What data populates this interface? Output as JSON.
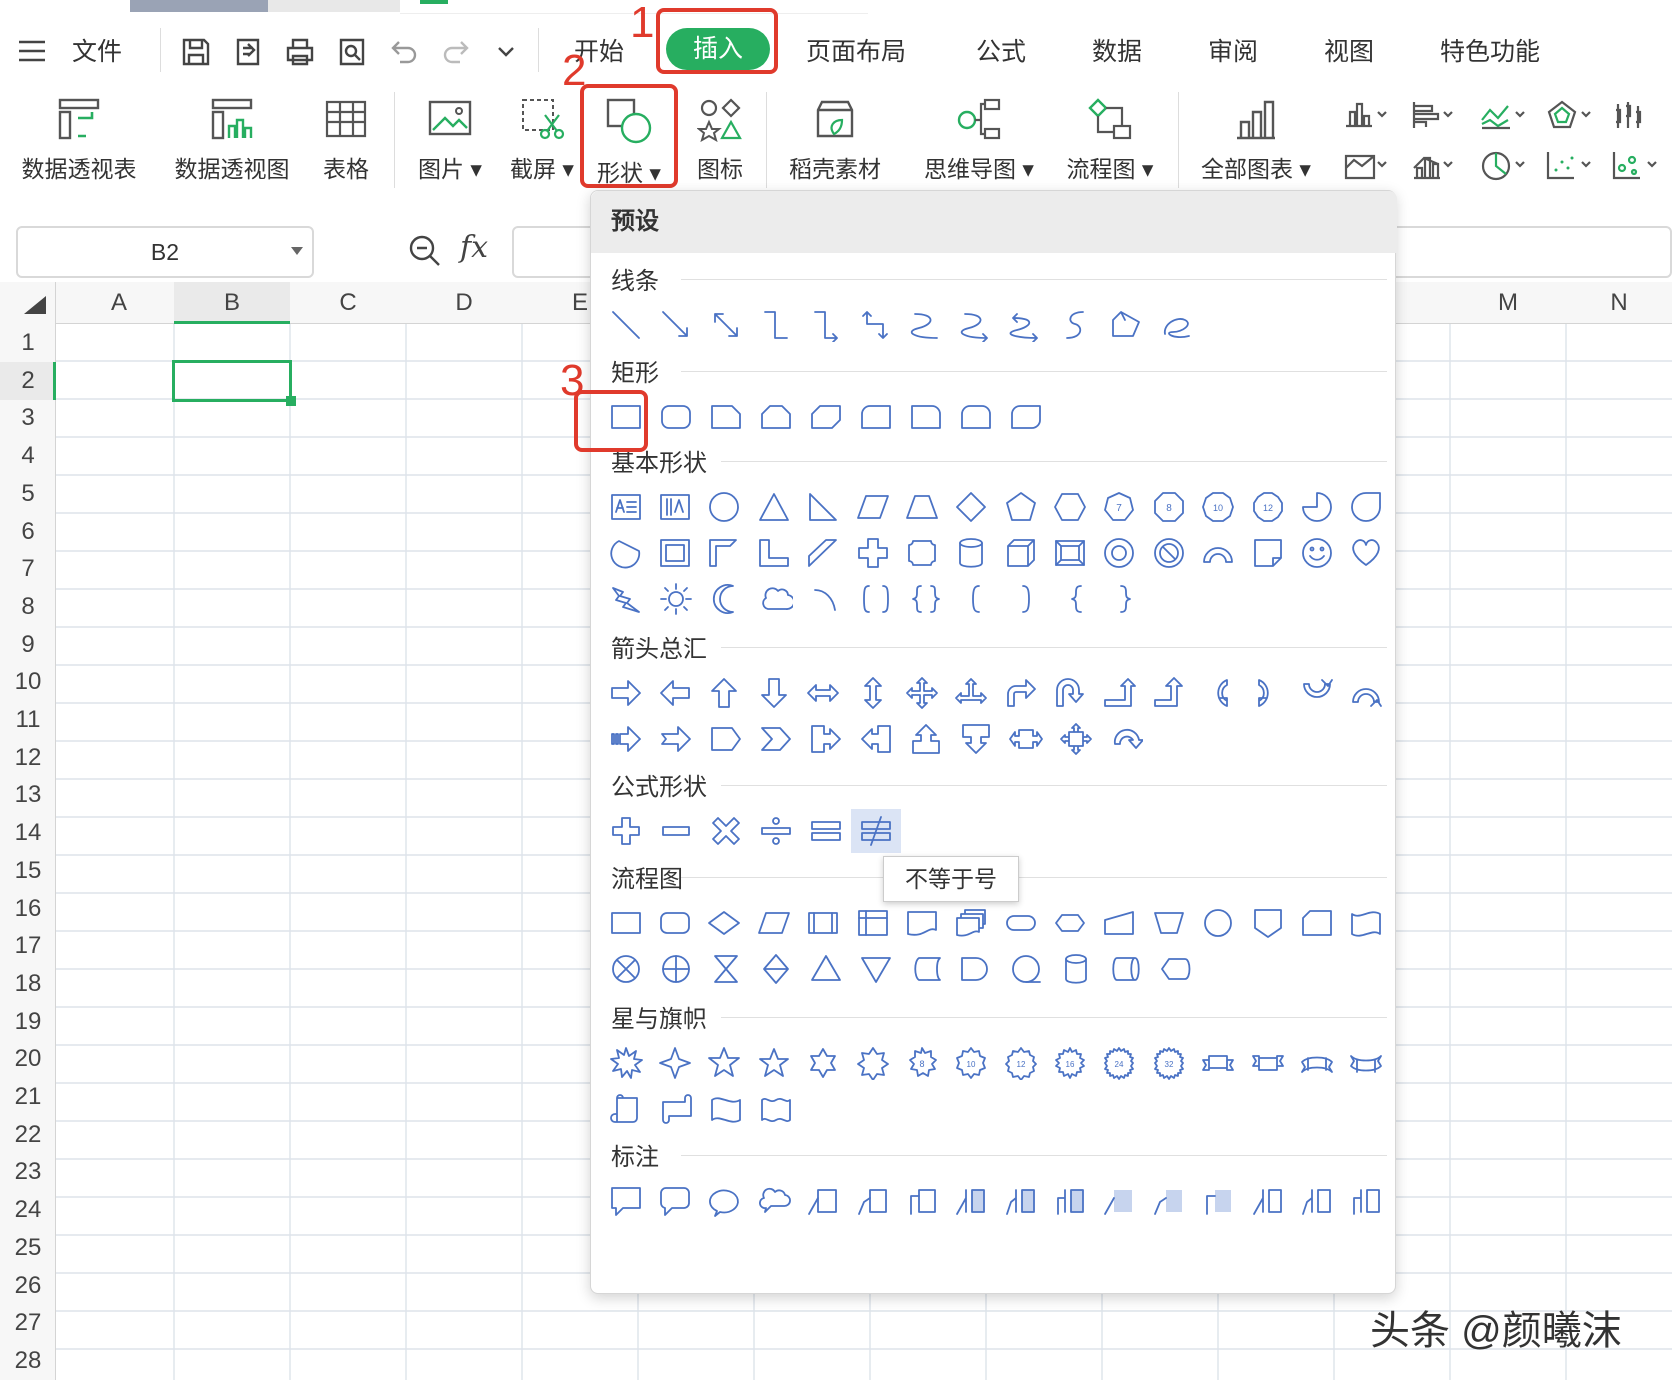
{
  "menubar": {
    "menu_label": "文件",
    "tabs": [
      "开始",
      "插入",
      "页面布局",
      "公式",
      "数据",
      "审阅",
      "视图",
      "特色功能"
    ],
    "active_tab": "插入",
    "accent": "#27ae60"
  },
  "ribbon": {
    "buttons": [
      {
        "label": "数据透视表",
        "icon": "pivot-table-icon"
      },
      {
        "label": "数据透视图",
        "icon": "pivot-chart-icon"
      },
      {
        "label": "表格",
        "icon": "table-icon"
      },
      {
        "label": "图片",
        "icon": "picture-icon",
        "dropdown": true
      },
      {
        "label": "截屏",
        "icon": "screenshot-icon",
        "dropdown": true
      },
      {
        "label": "形状",
        "icon": "shape-icon",
        "dropdown": true
      },
      {
        "label": "图标",
        "icon": "icons-icon"
      },
      {
        "label": "稻壳素材",
        "icon": "material-icon"
      },
      {
        "label": "思维导图",
        "icon": "mindmap-icon",
        "dropdown": true
      },
      {
        "label": "流程图",
        "icon": "flowchart-icon",
        "dropdown": true
      },
      {
        "label": "全部图表",
        "icon": "all-charts-icon",
        "dropdown": true
      }
    ]
  },
  "annotations": [
    "1",
    "2",
    "3"
  ],
  "formula": {
    "cell_ref": "B2",
    "fx": "fx"
  },
  "grid": {
    "columns": [
      "A",
      "B",
      "C",
      "D",
      "E",
      "M",
      "N"
    ],
    "rows": [
      "1",
      "2",
      "3",
      "4",
      "5",
      "6",
      "7",
      "8",
      "9",
      "10",
      "11",
      "12",
      "13",
      "14",
      "15",
      "16",
      "17",
      "18",
      "19",
      "20",
      "21",
      "22",
      "23",
      "24",
      "25",
      "26",
      "27",
      "28"
    ]
  },
  "dropdown": {
    "title": "预设",
    "sections": [
      "线条",
      "矩形",
      "基本形状",
      "箭头总汇",
      "公式形状",
      "流程图",
      "星与旗帜",
      "标注"
    ],
    "tooltip": "不等于号"
  },
  "watermark": "头条 @颜曦沫",
  "colors": {
    "shape_stroke": "#4a72c4",
    "red": "#e03a2c",
    "green": "#27ae60"
  }
}
